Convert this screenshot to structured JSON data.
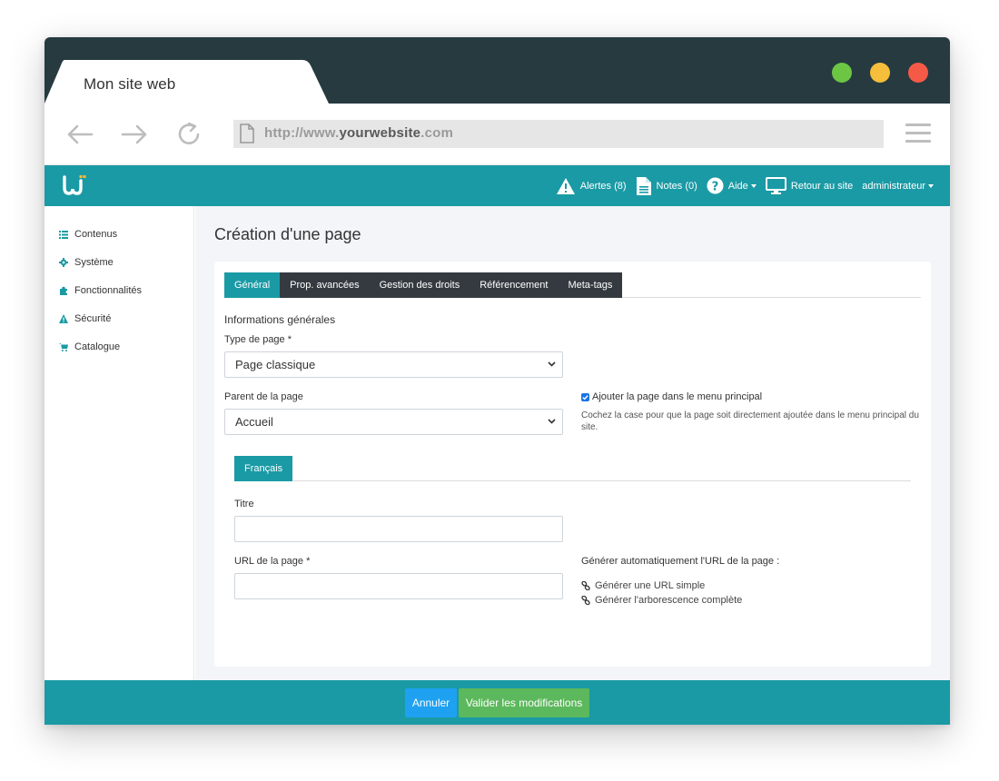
{
  "browser": {
    "tab_title": "Mon site web",
    "url_prefix": "http://www.",
    "url_domain": "yourwebsite",
    "url_suffix": ".com",
    "window_dots": {
      "green": "#6cc644",
      "yellow": "#f5be3b",
      "red": "#f55a47"
    }
  },
  "appbar": {
    "logo": "wi-logo",
    "alerts_label": "Alertes (8)",
    "notes_label": "Notes (0)",
    "help_label": "Aide",
    "back_site_label": "Retour au site",
    "user_label": "administrateur",
    "color": "#1a9aa5"
  },
  "sidebar": {
    "items": [
      {
        "label": "Contenus",
        "icon": "list-icon"
      },
      {
        "label": "Système",
        "icon": "gear-icon"
      },
      {
        "label": "Fonctionnalités",
        "icon": "puzzle-icon"
      },
      {
        "label": "Sécurité",
        "icon": "warning-icon"
      },
      {
        "label": "Catalogue",
        "icon": "cart-icon"
      }
    ]
  },
  "main": {
    "page_title": "Création d'une page",
    "tabs": [
      {
        "label": "Général",
        "active": true
      },
      {
        "label": "Prop. avancées",
        "active": false
      },
      {
        "label": "Gestion des droits",
        "active": false
      },
      {
        "label": "Référencement",
        "active": false
      },
      {
        "label": "Meta-tags",
        "active": false
      }
    ],
    "section_title": "Informations générales",
    "page_type_label": "Type de page *",
    "page_type_value": "Page classique",
    "parent_label": "Parent de la page",
    "parent_value": "Accueil",
    "add_menu_label": "Ajouter la page dans le menu principal",
    "add_menu_checked": true,
    "add_menu_help": "Cochez la case pour que la page soit directement ajoutée dans le menu principal du site.",
    "lang_tab": "Français",
    "title_label": "Titre",
    "title_value": "",
    "url_label": "URL de la page *",
    "url_value": "",
    "auto_url_label": "Générer automatiquement l'URL de la page :",
    "gen_simple": "Générer une URL simple",
    "gen_tree": "Générer l'arborescence complète"
  },
  "footer": {
    "cancel_label": "Annuler",
    "submit_label": "Valider les modifications",
    "cancel_color": "#1ea1f1",
    "submit_color": "#5cb85c"
  }
}
